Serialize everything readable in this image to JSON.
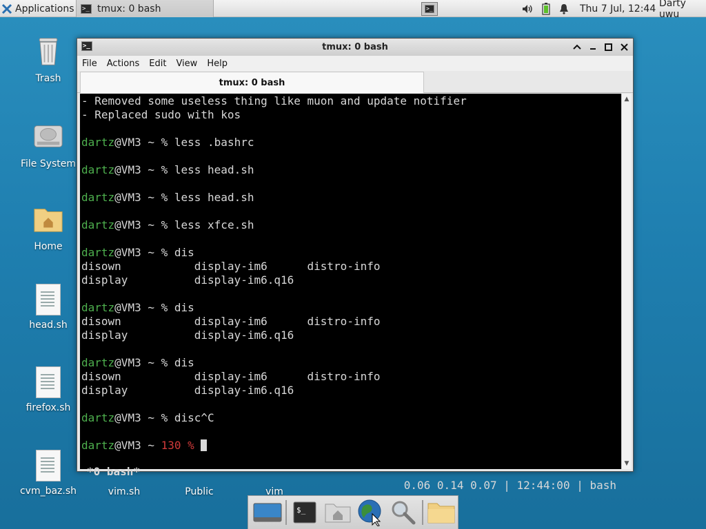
{
  "top_panel": {
    "apps_label": "Applications",
    "task_label": "tmux: 0 bash",
    "clock": "Thu  7 Jul, 12:44",
    "user": "Darty uwu"
  },
  "desktop_icons": [
    {
      "label": "Trash"
    },
    {
      "label": "File System"
    },
    {
      "label": "Home"
    },
    {
      "label": "head.sh"
    },
    {
      "label": "firefox.sh"
    },
    {
      "label": "cvm_baz.sh"
    },
    {
      "label": "vim.sh"
    },
    {
      "label": "Public"
    },
    {
      "label": "vim"
    }
  ],
  "window": {
    "title": "tmux: 0 bash",
    "menu": [
      "File",
      "Actions",
      "Edit",
      "View",
      "Help"
    ],
    "tab_label": "tmux: 0 bash"
  },
  "prompt": {
    "user": "dartz",
    "host": "@VM3 ~ % "
  },
  "terminal": {
    "lines": [
      "- Removed some useless thing like muon and update notifier",
      "- Replaced sudo with kos",
      "",
      "less .bashrc",
      "",
      "less head.sh",
      "",
      "less head.sh",
      "",
      "less xfce.sh",
      "",
      "dis",
      "disown           display-im6      distro-info",
      "display          display-im6.q16",
      "",
      "dis",
      "disown           display-im6      distro-info",
      "display          display-im6.q16",
      "",
      "dis",
      "disown           display-im6      distro-info",
      "display          display-im6.q16",
      "",
      "disc^C",
      ""
    ],
    "last_prompt_host": "@VM3 ~ ",
    "last_prompt_code": "130 % ",
    "status_left": "*0 bash*",
    "status_right": "0.06 0.14 0.07 | 12:44:00 | bash"
  },
  "colors": {
    "prompt_user": "#4eb04e",
    "error_code": "#d23a3a",
    "desktop": "#1f7fb0"
  }
}
